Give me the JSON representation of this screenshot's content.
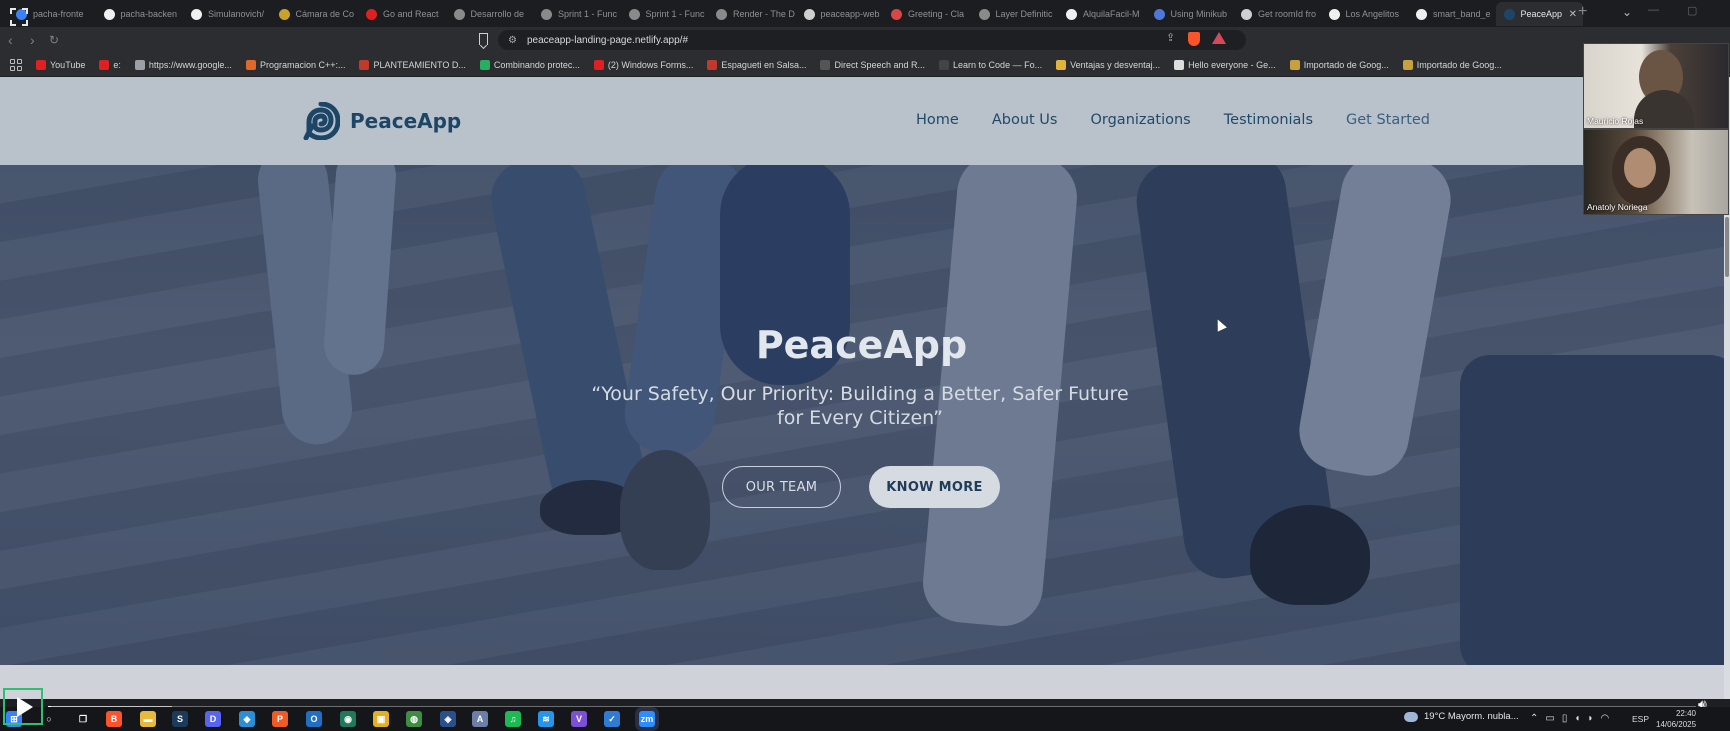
{
  "browser": {
    "tabs": [
      {
        "title": "pacha-fronte",
        "color": "#3b82f6"
      },
      {
        "title": "pacha-backen",
        "color": "#f0f0f0",
        "glyph": "●"
      },
      {
        "title": "Simulanovich/",
        "color": "#f0f0f0",
        "glyph": "●"
      },
      {
        "title": "Cámara de Co",
        "color": "#c9a227"
      },
      {
        "title": "Go and React",
        "color": "#e02020"
      },
      {
        "title": "Desarrollo de",
        "color": "#8a8a8a"
      },
      {
        "title": "Sprint 1 - Func",
        "color": "#8a8a8a"
      },
      {
        "title": "Sprint 1 - Func",
        "color": "#8a8a8a"
      },
      {
        "title": "Render - The D",
        "color": "#8a8a8a"
      },
      {
        "title": "peaceapp-web",
        "color": "#cfcfcf"
      },
      {
        "title": "Greeting - Cla",
        "color": "#d44"
      },
      {
        "title": "Layer Definitic",
        "color": "#8a8a8a"
      },
      {
        "title": "AlquilaFacil-M",
        "color": "#f0f0f0",
        "glyph": "●"
      },
      {
        "title": "Using Minikub",
        "color": "#4f78d6"
      },
      {
        "title": "Get roomId fro",
        "color": "#cfcfcf"
      },
      {
        "title": "Los Angelitos",
        "color": "#f0f0f0",
        "glyph": "●"
      },
      {
        "title": "smart_band_e",
        "color": "#f0f0f0",
        "glyph": "●"
      },
      {
        "title": "PeaceApp",
        "color": "#1d4666",
        "active": true
      }
    ],
    "new_tab_label": "+",
    "url": "peaceapp-landing-page.netlify.app/#",
    "bookmarks": [
      {
        "label": "YouTube",
        "color": "#e02020"
      },
      {
        "label": "e:",
        "color": "#e02020"
      },
      {
        "label": "https://www.google...",
        "color": "#9aa0a6"
      },
      {
        "label": "Programacion C++:...",
        "color": "#e0692a"
      },
      {
        "label": "PLANTEAMIENTO D...",
        "color": "#c0392b"
      },
      {
        "label": "Combinando protec...",
        "color": "#27ae60"
      },
      {
        "label": "(2) Windows Forms...",
        "color": "#e02020"
      },
      {
        "label": "Espagueti en Salsa...",
        "color": "#c0392b"
      },
      {
        "label": "Direct Speech and R...",
        "color": "#555"
      },
      {
        "label": "Learn to Code — Fo...",
        "color": "#444"
      },
      {
        "label": "Ventajas y desventaj...",
        "color": "#e2b33c"
      },
      {
        "label": "Hello everyone - Ge...",
        "color": "#ddd"
      },
      {
        "label": "Importado de Goog...",
        "color": "#c8a040"
      },
      {
        "label": "Importado de Goog...",
        "color": "#c8a040"
      }
    ]
  },
  "site": {
    "brand": "PeaceApp",
    "nav": [
      "Home",
      "About Us",
      "Organizations",
      "Testimonials",
      "Get Started"
    ],
    "hero": {
      "title": "PeaceApp",
      "subtitle": "“Your Safety, Our Priority: Building a Better, Safer Future for Every Citizen”",
      "btn_outline": "OUR TEAM",
      "btn_solid": "KNOW MORE"
    },
    "brand_color": "#1d4666"
  },
  "video_call": {
    "participants": [
      "Mauricio Rojas",
      "Anatoly Noriega"
    ]
  },
  "player": {
    "progress_fraction": 0.002,
    "buffer_fraction": 0.075
  },
  "taskbar": {
    "apps": [
      {
        "name": "windows-start",
        "color": "#3b82f6",
        "glyph": "⊞"
      },
      {
        "name": "search",
        "color": "#15161a",
        "glyph": "○"
      },
      {
        "name": "task-view",
        "color": "#15161a",
        "glyph": "❐"
      },
      {
        "name": "brave",
        "color": "#fb542b",
        "glyph": "B"
      },
      {
        "name": "file-explorer",
        "color": "#e8b93a",
        "glyph": "▬"
      },
      {
        "name": "steam",
        "color": "#1b3a5c",
        "glyph": "S"
      },
      {
        "name": "discord",
        "color": "#5865f2",
        "glyph": "D"
      },
      {
        "name": "vscode",
        "color": "#2c8fd6",
        "glyph": "◆"
      },
      {
        "name": "postman",
        "color": "#ef5b25",
        "glyph": "P"
      },
      {
        "name": "outlook",
        "color": "#1f6fc4",
        "glyph": "O"
      },
      {
        "name": "app-green",
        "color": "#1f7a5a",
        "glyph": "◉"
      },
      {
        "name": "app-yellow",
        "color": "#e3b021",
        "glyph": "▣"
      },
      {
        "name": "app-mongo",
        "color": "#3e8e41",
        "glyph": "◍"
      },
      {
        "name": "app-blue",
        "color": "#2a4f8c",
        "glyph": "◈"
      },
      {
        "name": "app-a",
        "color": "#6b7fa8",
        "glyph": "A"
      },
      {
        "name": "spotify",
        "color": "#1db954",
        "glyph": "♫"
      },
      {
        "name": "docker",
        "color": "#2496ed",
        "glyph": "≋"
      },
      {
        "name": "visual-studio",
        "color": "#7b4fd6",
        "glyph": "V"
      },
      {
        "name": "todo",
        "color": "#2e7cd6",
        "glyph": "✓"
      },
      {
        "name": "zoom",
        "color": "#2d8cff",
        "glyph": "zm",
        "active": true
      }
    ],
    "weather": "19°C  Mayorm. nubla...",
    "lang": "ESP",
    "time": "22:40",
    "date": "14/06/2025"
  }
}
